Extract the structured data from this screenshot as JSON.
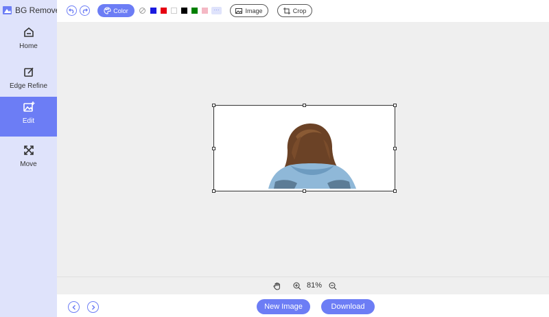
{
  "app": {
    "title": "BG Remover"
  },
  "sidebar": {
    "items": [
      {
        "label": "Home",
        "icon": "home-icon"
      },
      {
        "label": "Edge Refine",
        "icon": "edit-pen-icon"
      },
      {
        "label": "Edit",
        "icon": "image-plus-icon",
        "active": true
      },
      {
        "label": "Move",
        "icon": "move-arrows-icon"
      }
    ]
  },
  "toolbar": {
    "color_label": "Color",
    "swatches": [
      "none",
      "#1a1adf",
      "#e60012",
      "#ffffff",
      "#000000",
      "#008000",
      "#f4b8c4"
    ],
    "more_label": "···",
    "image_label": "Image",
    "crop_label": "Crop"
  },
  "zoom": {
    "value": "81%"
  },
  "footer": {
    "new_image_label": "New Image",
    "download_label": "Download"
  },
  "colors": {
    "accent": "#6c7df5",
    "sidebar_bg": "#dfe3fb",
    "canvas_bg": "#efefef"
  }
}
